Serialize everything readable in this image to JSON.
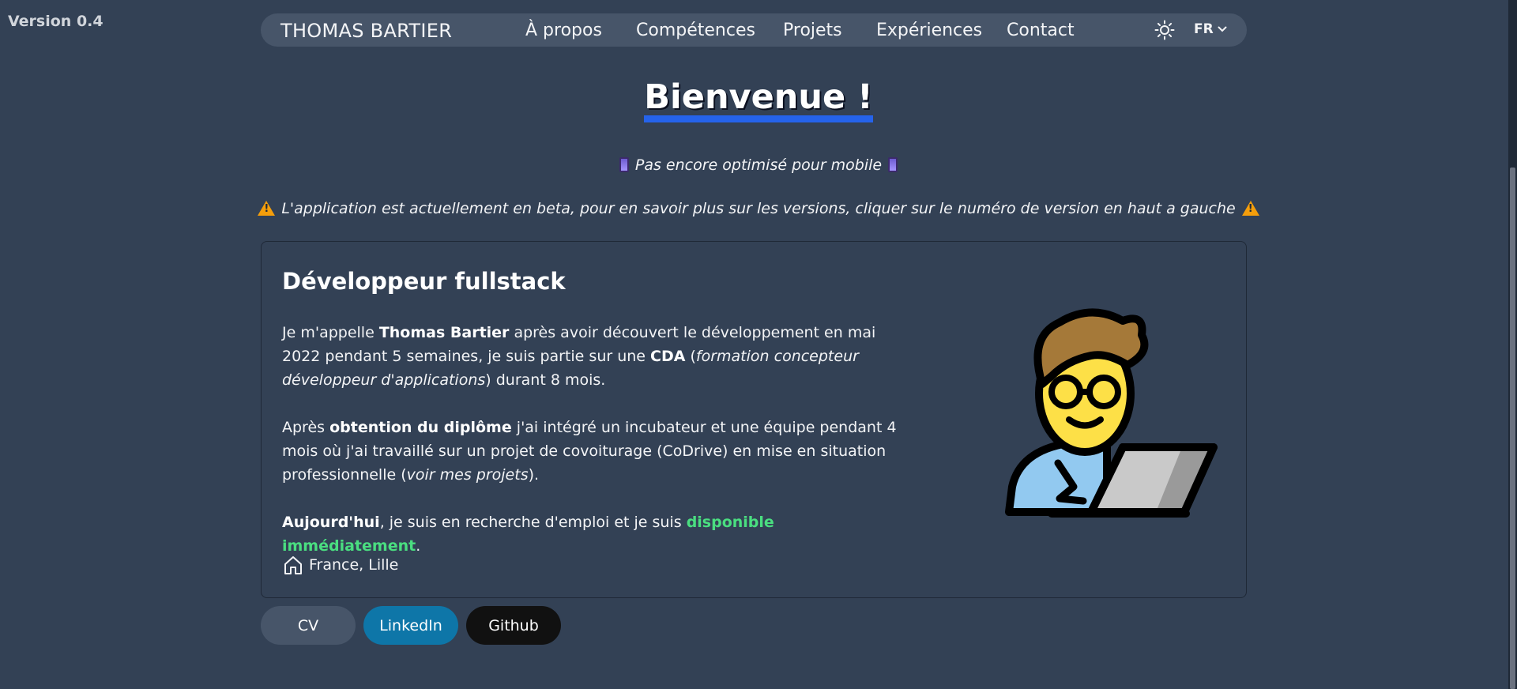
{
  "version": "Version 0.4",
  "nav": {
    "brand": "THOMAS BARTIER",
    "links": [
      "À propos",
      "Compétences",
      "Projets",
      "Expériences",
      "Contact"
    ],
    "theme_icon": "sun-icon",
    "language": "FR"
  },
  "hero": {
    "title": "Bienvenue !",
    "mobile_notice": "Pas encore optimisé pour mobile",
    "beta_notice": "L'application est actuellement en beta, pour en savoir plus sur les versions, cliquer sur le numéro de version en haut a gauche"
  },
  "card": {
    "title": "Développeur fullstack",
    "p1": {
      "t1": "Je m'appelle ",
      "b1": "Thomas Bartier",
      "t2": " après avoir découvert le développement en mai 2022 pendant 5 semaines, je suis partie sur une ",
      "b2": "CDA",
      "t3": " (",
      "i1": "formation concepteur développeur d'applications",
      "t4": ") durant 8 mois."
    },
    "p2": {
      "t1": "Après ",
      "b1": "obtention du diplôme",
      "t2": " j'ai intégré un incubateur et une équipe pendant 4 mois où j'ai travaillé sur un projet de covoiturage (CoDrive) en mise en situation professionnelle (",
      "i1": "voir mes projets",
      "t3": ")."
    },
    "p3": {
      "b1": "Aujourd'hui",
      "t1": ", je suis en recherche d'emploi et je suis ",
      "g1": "disponible immédiatement",
      "t2": "."
    },
    "location": "France, Lille",
    "illustration_icon": "technologist-icon"
  },
  "buttons": {
    "cv": "CV",
    "linkedin": "LinkedIn",
    "github": "Github"
  },
  "colors": {
    "background": "#334155",
    "nav_bg": "#475569",
    "accent_blue": "#2563eb",
    "green": "#4ade80",
    "linkedin": "#0e76a8",
    "github": "#111111"
  }
}
